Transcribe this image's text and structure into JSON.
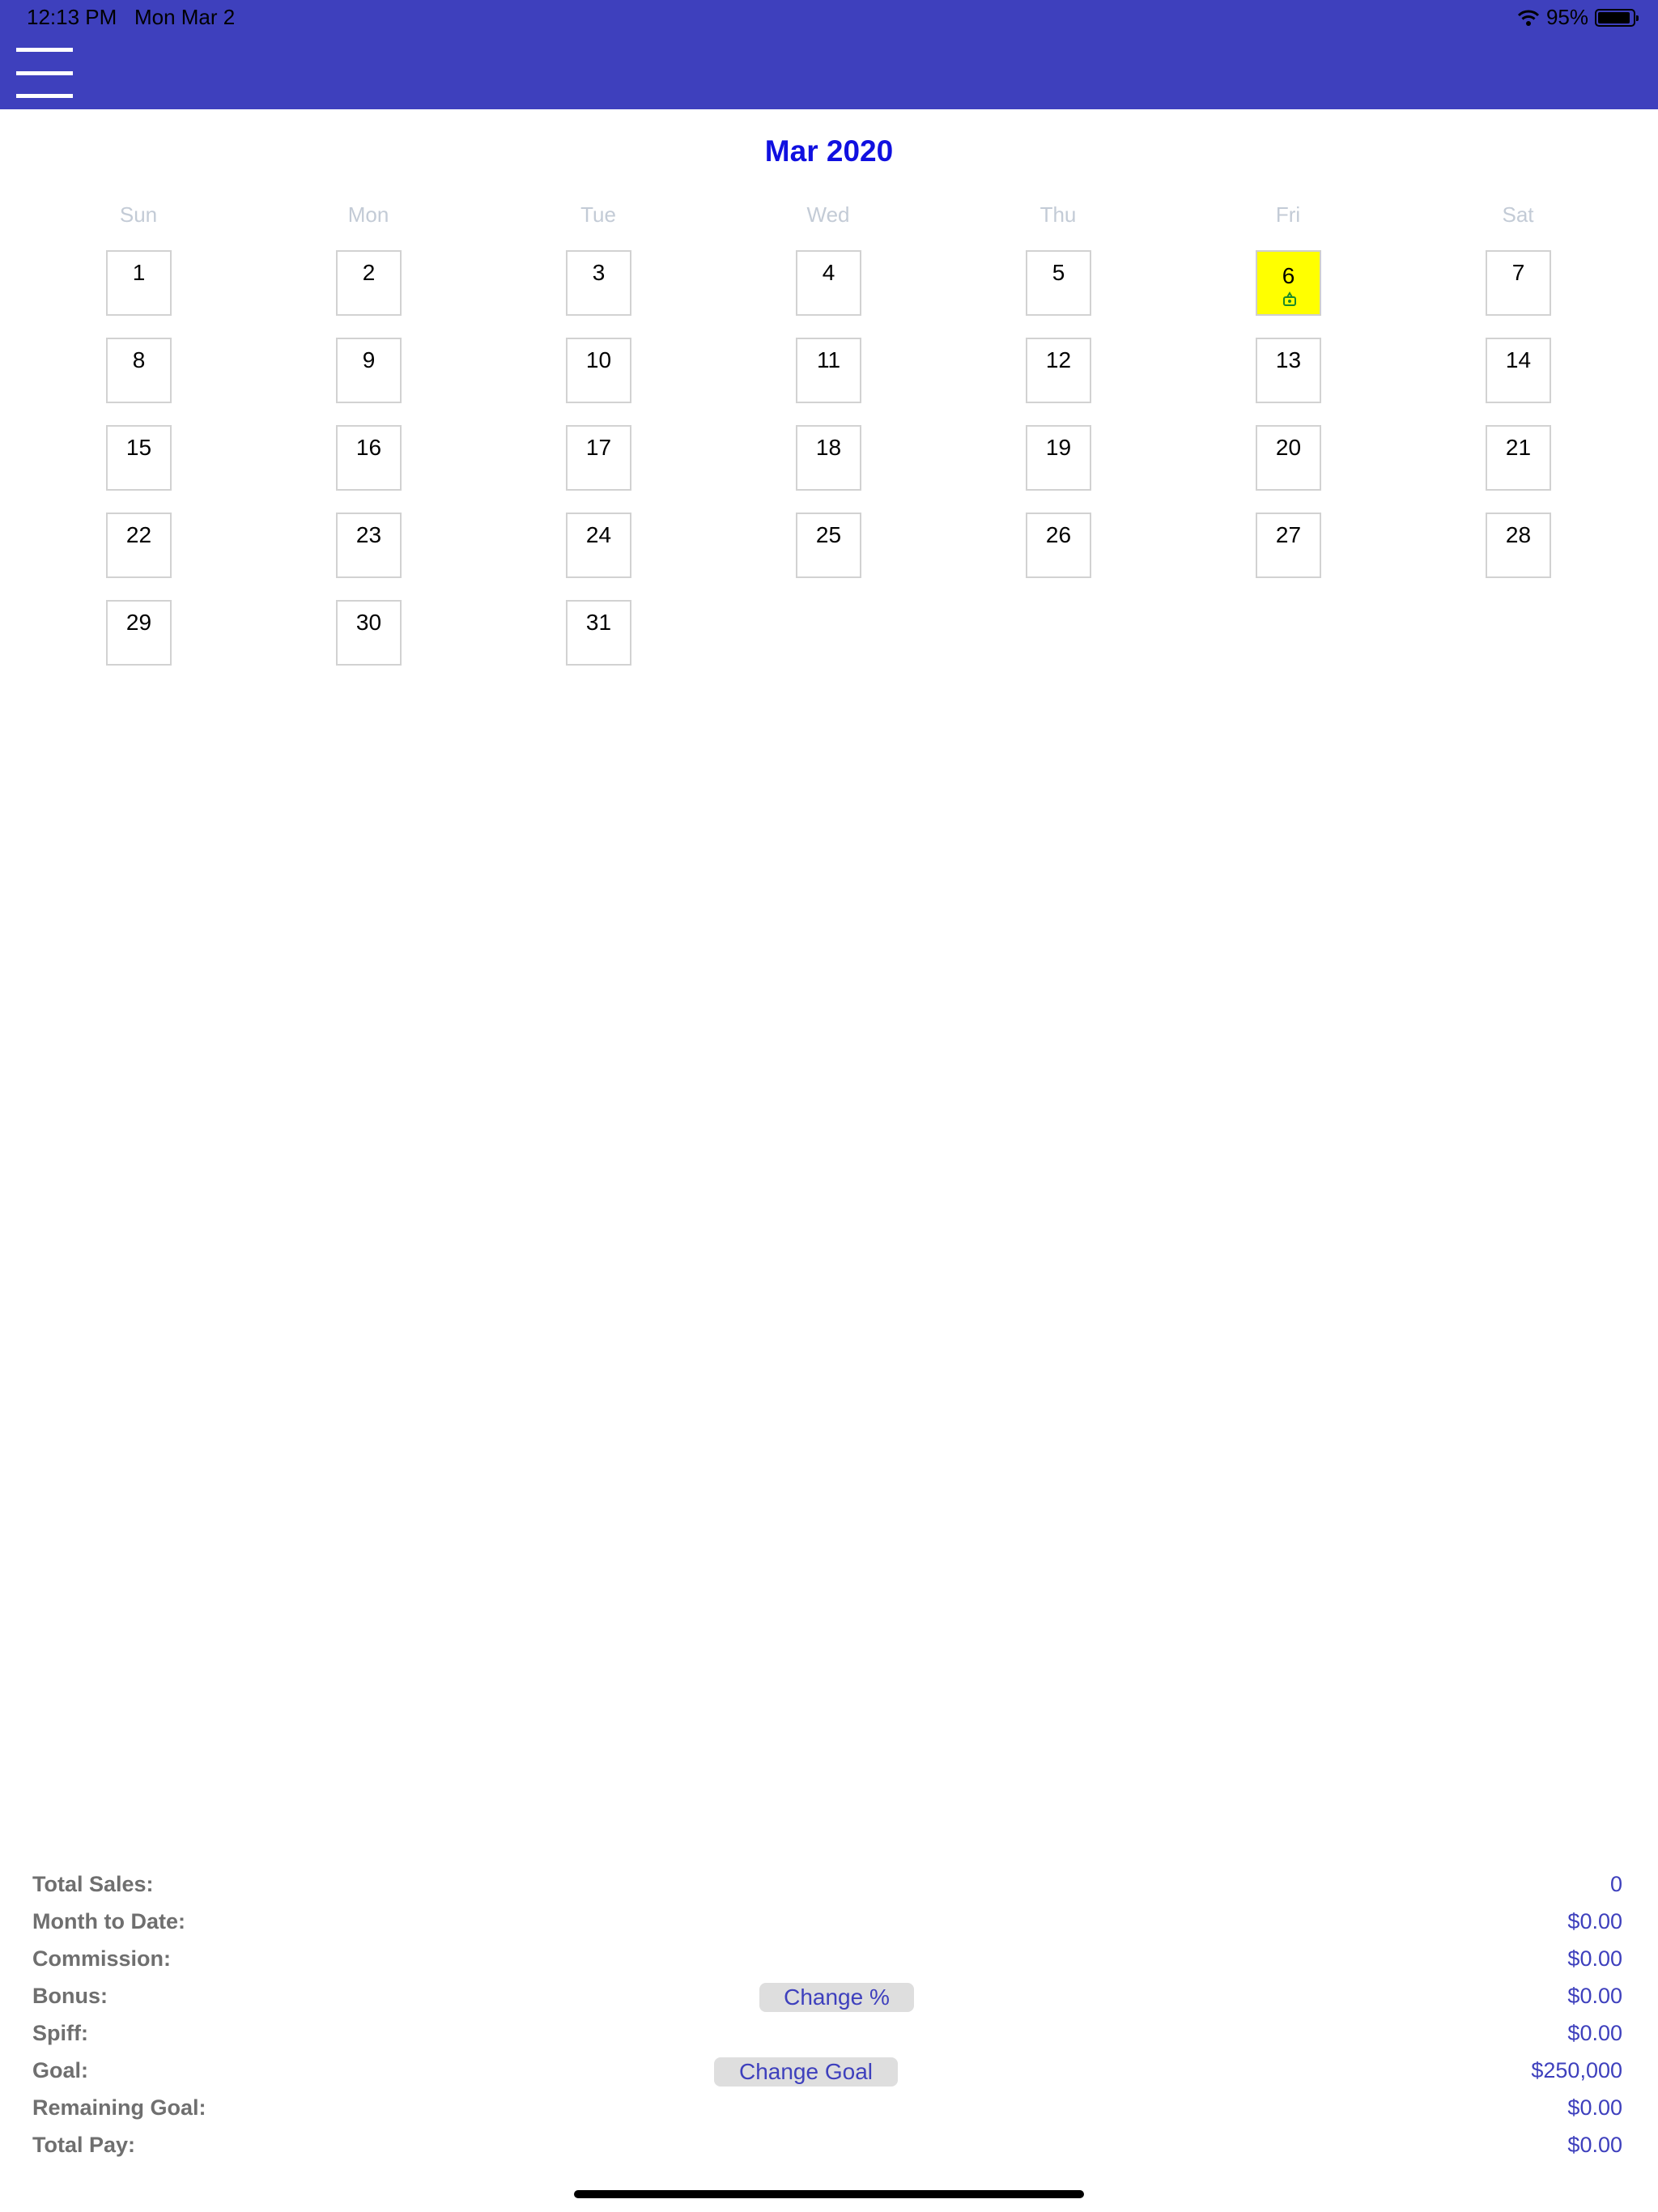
{
  "status_bar": {
    "time": "12:13 PM",
    "date": "Mon Mar 2",
    "battery": "95%",
    "battery_level": 0.95
  },
  "header": {
    "menu_icon": "hamburger-menu-icon",
    "background_color": "#3e40bd"
  },
  "calendar": {
    "month_title": "Mar 2020",
    "weekdays": [
      "Sun",
      "Mon",
      "Tue",
      "Wed",
      "Thu",
      "Fri",
      "Sat"
    ],
    "days": [
      "1",
      "2",
      "3",
      "4",
      "5",
      "6",
      "7",
      "8",
      "9",
      "10",
      "11",
      "12",
      "13",
      "14",
      "15",
      "16",
      "17",
      "18",
      "19",
      "20",
      "21",
      "22",
      "23",
      "24",
      "25",
      "26",
      "27",
      "28",
      "29",
      "30",
      "31"
    ],
    "highlighted_day": "6",
    "highlight_color": "#ffff00",
    "highlighted_icon": "money-bag-icon"
  },
  "summary": {
    "total_sales_label": "Total Sales:",
    "total_sales_value": "0",
    "month_to_date_label": "Month to Date:",
    "month_to_date_value": "$0.00",
    "commission_label": "Commission:",
    "commission_value": "$0.00",
    "bonus_label": "Bonus:",
    "bonus_value": "$0.00",
    "spiff_label": "Spiff:",
    "spiff_value": "$0.00",
    "goal_label": "Goal:",
    "goal_value": "$250,000",
    "remaining_goal_label": "Remaining Goal:",
    "remaining_goal_value": "$0.00",
    "total_pay_label": "Total Pay:",
    "total_pay_value": "$0.00",
    "change_percent_button": "Change %",
    "change_goal_button": "Change Goal"
  }
}
